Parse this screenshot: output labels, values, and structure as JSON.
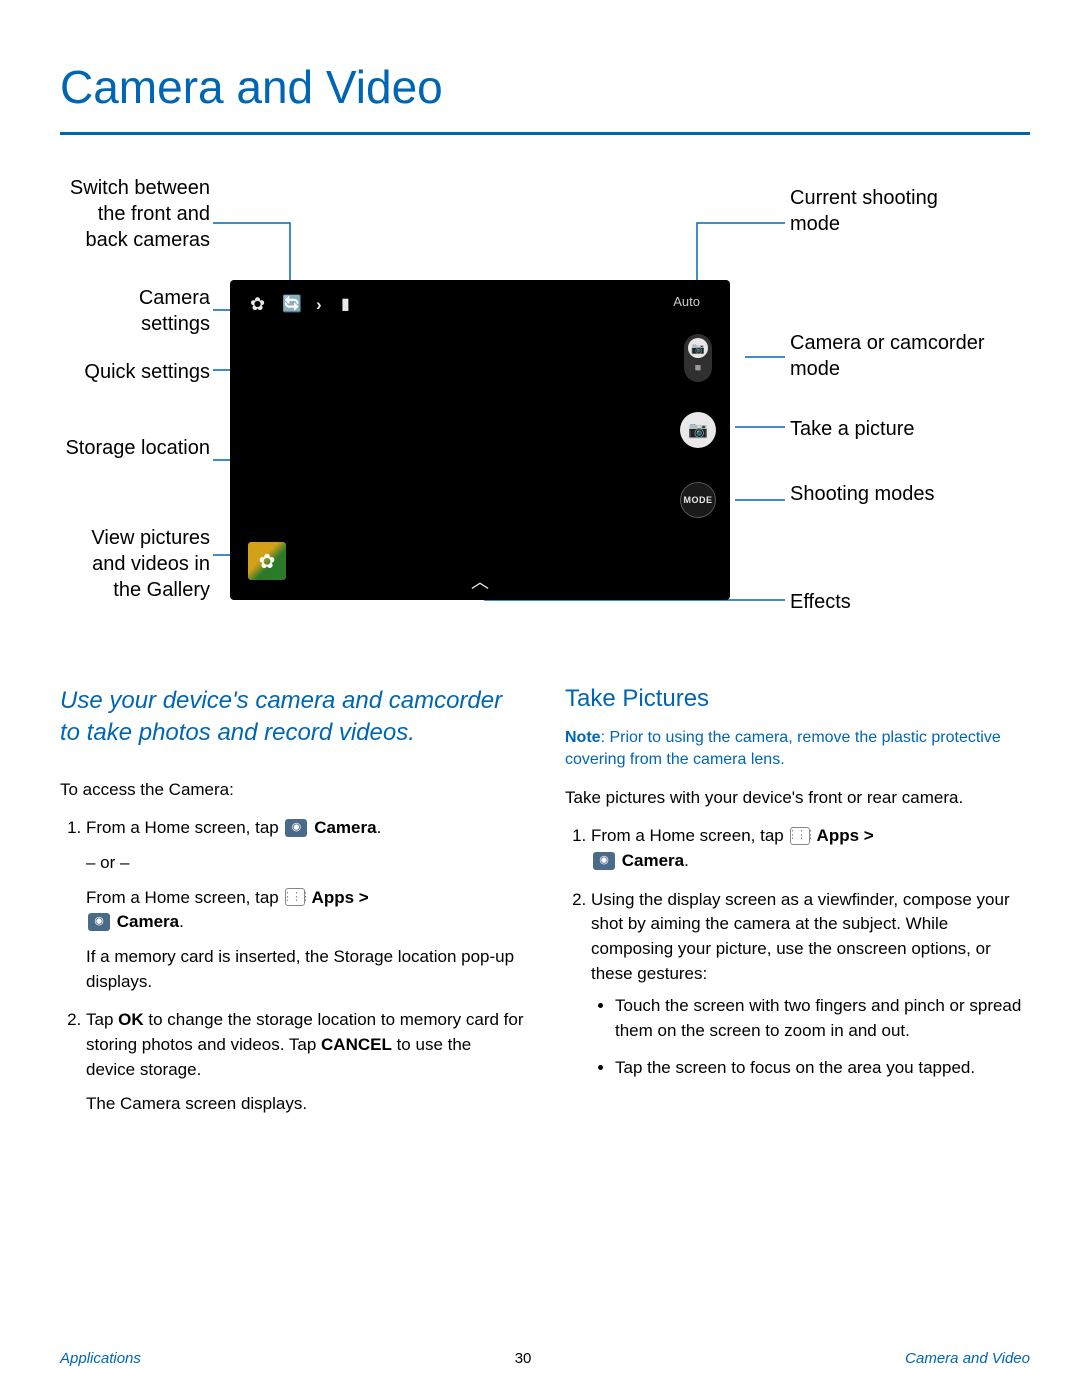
{
  "title": "Camera and Video",
  "diagram": {
    "auto_label": "Auto",
    "mode_label": "MODE",
    "callouts": {
      "switch_cam": "Switch between the front and back cameras",
      "camera_settings": "Camera settings",
      "quick_settings": "Quick settings",
      "storage": "Storage location",
      "gallery": "View pictures and videos in the Gallery",
      "shooting_mode": "Current shooting mode",
      "cam_camcorder": "Camera or camcorder mode",
      "take_picture": "Take a picture",
      "shooting_modes": "Shooting modes",
      "effects": "Effects"
    }
  },
  "intro": "Use your device's camera and camcorder to take photos and record videos.",
  "access_label": "To access the Camera:",
  "step1a": "From a Home screen, tap ",
  "step1a_after": " Camera",
  "step1_or": "– or –",
  "step1b": "From a Home screen, tap ",
  "step1b_apps": " Apps > ",
  "step1b_cam": " Camera",
  "step1_mem": "If a memory card is inserted, the Storage location pop-up displays.",
  "step2": "Tap OK to change the storage location to memory card for storing photos and videos. Tap CANCEL to use the device storage.",
  "step2_after": "The Camera screen displays.",
  "take_pictures_h": "Take Pictures",
  "note_label": "Note",
  "note_body": ": Prior to using the camera, remove the plastic protective covering from the camera lens.",
  "take_intro": "Take pictures with your device's front or rear camera.",
  "r_step1": "From a Home screen, tap ",
  "r_step1_apps": " Apps > ",
  "r_step1_cam": " Camera",
  "r_step2": "Using the display screen as a viewfinder, compose your shot by aiming the camera at the subject. While composing your picture, use the onscreen options, or these gestures:",
  "r_bullet1": "Touch the screen with two fingers and pinch or spread them on the screen to zoom in and out.",
  "r_bullet2": "Tap the screen to focus on the area you tapped.",
  "footer": {
    "left": "Applications",
    "page": "30",
    "right": "Camera and Video"
  }
}
